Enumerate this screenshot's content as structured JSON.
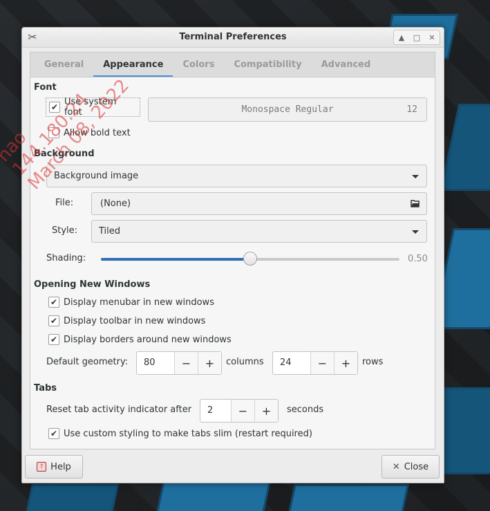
{
  "watermark": {
    "lines": [
      "nao",
      "144.180.24",
      "March 08, 2022"
    ]
  },
  "window": {
    "title": "Terminal Preferences",
    "controls": [
      "up-icon",
      "maximize-icon",
      "close-icon"
    ]
  },
  "tabs": [
    {
      "label": "General",
      "active": false
    },
    {
      "label": "Appearance",
      "active": true
    },
    {
      "label": "Colors",
      "active": false
    },
    {
      "label": "Compatibility",
      "active": false
    },
    {
      "label": "Advanced",
      "active": false
    }
  ],
  "font": {
    "heading": "Font",
    "use_system_font": {
      "label": "Use system font",
      "checked": true
    },
    "font_button": {
      "name": "Monospace Regular",
      "size": "12"
    },
    "allow_bold": {
      "label": "Allow bold text",
      "checked": false
    }
  },
  "background": {
    "heading": "Background",
    "type_value": "Background image",
    "file_label": "File:",
    "file_value": "(None)",
    "style_label": "Style:",
    "style_value": "Tiled",
    "shading_label": "Shading:",
    "shading_value": "0.50",
    "shading_fraction": 0.5
  },
  "new_windows": {
    "heading": "Opening New Windows",
    "menubar": {
      "label": "Display menubar in new windows",
      "checked": true
    },
    "toolbar": {
      "label": "Display toolbar in new windows",
      "checked": true
    },
    "borders": {
      "label": "Display borders around new windows",
      "checked": true
    },
    "geometry_label": "Default geometry:",
    "columns_value": "80",
    "columns_label": "columns",
    "rows_value": "24",
    "rows_label": "rows"
  },
  "tabs_section": {
    "heading": "Tabs",
    "reset_label": "Reset tab activity indicator after",
    "reset_value": "2",
    "seconds_label": "seconds",
    "slim": {
      "label": "Use custom styling to make tabs slim (restart required)",
      "checked": true
    }
  },
  "footer": {
    "help_label": "Help",
    "close_label": "Close"
  },
  "glyphs": {
    "check": "✔",
    "minus": "−",
    "plus": "+",
    "close_x": "✕"
  }
}
